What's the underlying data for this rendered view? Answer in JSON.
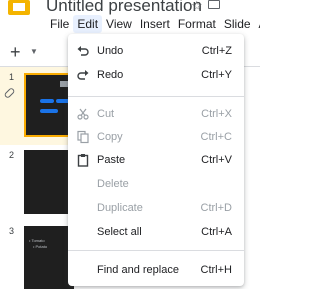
{
  "header": {
    "title": "Untitled presentation",
    "menus": [
      "File",
      "Edit",
      "View",
      "Insert",
      "Format",
      "Slide",
      "A"
    ]
  },
  "filmstrip": {
    "slides": [
      "1",
      "2",
      "3"
    ],
    "slide3_text": [
      "•  Tomato",
      "•  Potato"
    ]
  },
  "edit_menu": {
    "items": [
      {
        "label": "Undo",
        "shortcut": "Ctrl+Z",
        "icon": "undo-icon",
        "enabled": true
      },
      {
        "label": "Redo",
        "shortcut": "Ctrl+Y",
        "icon": "redo-icon",
        "enabled": true
      },
      {
        "label": "Cut",
        "shortcut": "Ctrl+X",
        "icon": "scissors-icon",
        "enabled": false
      },
      {
        "label": "Copy",
        "shortcut": "Ctrl+C",
        "icon": "copy-icon",
        "enabled": false
      },
      {
        "label": "Paste",
        "shortcut": "Ctrl+V",
        "icon": "clipboard-icon",
        "enabled": true
      },
      {
        "label": "Delete",
        "shortcut": "",
        "icon": "",
        "enabled": false
      },
      {
        "label": "Duplicate",
        "shortcut": "Ctrl+D",
        "icon": "",
        "enabled": false
      },
      {
        "label": "Select all",
        "shortcut": "Ctrl+A",
        "icon": "",
        "enabled": true
      },
      {
        "label": "Find and replace",
        "shortcut": "Ctrl+H",
        "icon": "",
        "enabled": true
      }
    ]
  },
  "colors": {
    "accent": "#1a73e8",
    "selected_slide_bg": "#fef7e0",
    "selected_slide_border": "#f9ab00",
    "logo": "#f4b400"
  }
}
